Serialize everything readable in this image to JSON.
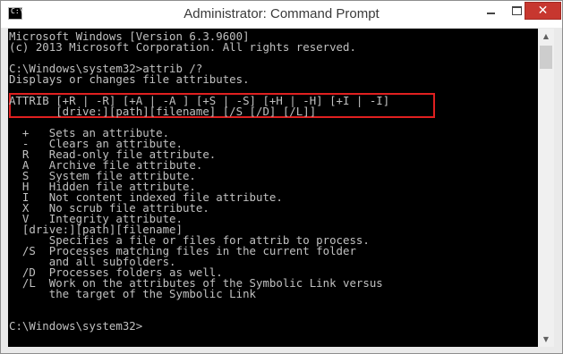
{
  "window": {
    "title": "Administrator: Command Prompt",
    "icon": "cmd-icon",
    "icon_label": "C:\\",
    "close_glyph": "✕"
  },
  "console": {
    "lines": [
      "Microsoft Windows [Version 6.3.9600]",
      "(c) 2013 Microsoft Corporation. All rights reserved.",
      "",
      "C:\\Windows\\system32>attrib /?",
      "Displays or changes file attributes.",
      "",
      "ATTRIB [+R | -R] [+A | -A ] [+S | -S] [+H | -H] [+I | -I]",
      "       [drive:][path][filename] [/S [/D] [/L]]",
      "",
      "  +   Sets an attribute.",
      "  -   Clears an attribute.",
      "  R   Read-only file attribute.",
      "  A   Archive file attribute.",
      "  S   System file attribute.",
      "  H   Hidden file attribute.",
      "  I   Not content indexed file attribute.",
      "  X   No scrub file attribute.",
      "  V   Integrity attribute.",
      "  [drive:][path][filename]",
      "      Specifies a file or files for attrib to process.",
      "  /S  Processes matching files in the current folder",
      "      and all subfolders.",
      "  /D  Processes folders as well.",
      "  /L  Work on the attributes of the Symbolic Link versus",
      "      the target of the Symbolic Link",
      "",
      "",
      "C:\\Windows\\system32>"
    ]
  },
  "colors": {
    "console_bg": "#000000",
    "console_text": "#c0c0c0",
    "highlight_border": "#e02020",
    "close_button": "#c7372f"
  }
}
